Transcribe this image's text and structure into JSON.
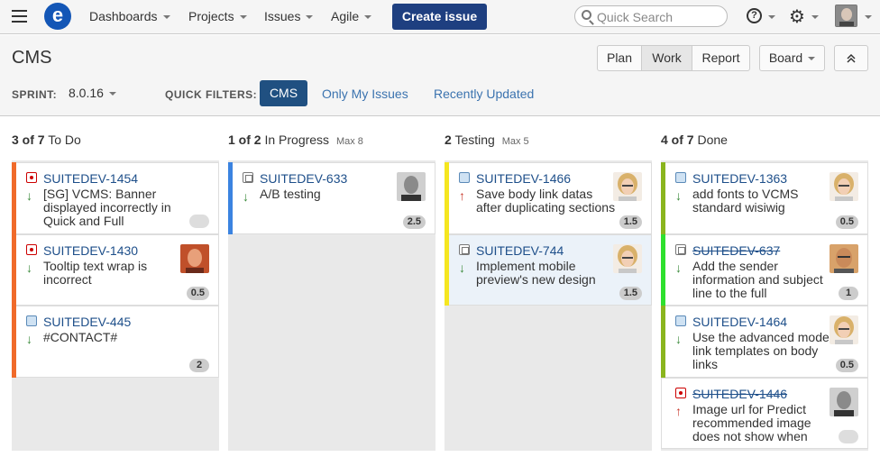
{
  "nav": {
    "items": [
      {
        "label": "Dashboards"
      },
      {
        "label": "Projects"
      },
      {
        "label": "Issues"
      },
      {
        "label": "Agile"
      }
    ],
    "create_label": "Create issue",
    "search_placeholder": "Quick Search",
    "icons": [
      "menu-icon",
      "logo-e",
      "search-icon",
      "help-icon",
      "gear-icon",
      "avatar"
    ]
  },
  "header": {
    "title": "CMS",
    "modes": [
      "Plan",
      "Work",
      "Report"
    ],
    "active_mode": "Work",
    "board_label": "Board",
    "sprint_label": "SPRINT:",
    "sprint_value": "8.0.16",
    "quick_filters_label": "QUICK FILTERS:",
    "quick_filters": [
      "CMS",
      "Only My Issues",
      "Recently Updated"
    ],
    "active_filter": "CMS"
  },
  "columns": [
    {
      "count": "3 of 7",
      "name": "To Do",
      "max": ""
    },
    {
      "count": "1 of 2",
      "name": "In Progress",
      "max": "Max 8"
    },
    {
      "count": "2",
      "name": "Testing",
      "max": "Max 5"
    },
    {
      "count": "4 of 7",
      "name": "Done",
      "max": ""
    }
  ],
  "cards": {
    "todo": [
      {
        "key": "SUITEDEV-1454",
        "summary": "[SG] VCMS: Banner displayed incorrectly in Quick and Full",
        "type": "bug",
        "priority": "down",
        "estimate": ""
      },
      {
        "key": "SUITEDEV-1430",
        "summary": "Tooltip text wrap is incorrect",
        "type": "bug",
        "priority": "down",
        "estimate": "0.5"
      },
      {
        "key": "SUITEDEV-445",
        "summary": "#CONTACT#",
        "type": "improvement",
        "priority": "down",
        "estimate": "2"
      }
    ],
    "progress": [
      {
        "key": "SUITEDEV-633",
        "summary": "A/B testing",
        "type": "story",
        "priority": "down",
        "estimate": "2.5"
      }
    ],
    "testing": [
      {
        "key": "SUITEDEV-1466",
        "summary": "Save body link datas after duplicating sections",
        "type": "improvement",
        "priority": "up",
        "estimate": "1.5"
      },
      {
        "key": "SUITEDEV-744",
        "summary": "Implement mobile preview's new design",
        "type": "story",
        "priority": "down",
        "estimate": "1.5"
      }
    ],
    "done": [
      {
        "key": "SUITEDEV-1363",
        "summary": "add fonts to VCMS standard wisiwig",
        "type": "improvement",
        "priority": "down",
        "estimate": "0.5"
      },
      {
        "key": "SUITEDEV-637",
        "summary": "Add the sender information and subject line to the full",
        "type": "story",
        "priority": "down",
        "estimate": "1"
      },
      {
        "key": "SUITEDEV-1464",
        "summary": "Use the advanced mode link templates on body links",
        "type": "improvement",
        "priority": "down",
        "estimate": "0.5"
      },
      {
        "key": "SUITEDEV-1446",
        "summary": "Image url for Predict recommended image does not show when",
        "type": "bug",
        "priority": "up",
        "estimate": ""
      }
    ]
  },
  "colors": {
    "brand": "#1356b6",
    "create_button": "#1e3f80",
    "active_filter": "#205081",
    "link": "#3b73af",
    "todo_grabber": "#f06a2a",
    "progress_grabber": "#3b83e0",
    "testing_grabber": "#f5e620",
    "done_grabber_olive": "#8ab51e",
    "done_grabber_green": "#2ee02e"
  }
}
